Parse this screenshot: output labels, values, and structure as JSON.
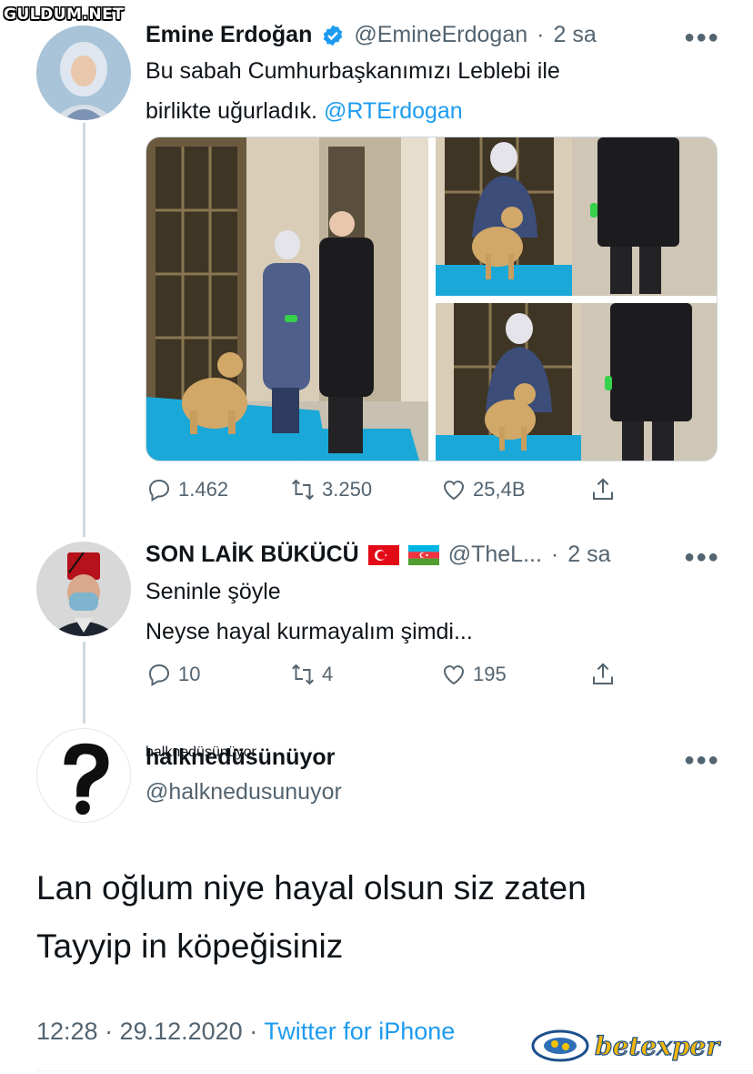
{
  "watermark": "GULDUM.NET",
  "tweet1": {
    "name": "Emine Erdoğan",
    "handle": "@EmineErdogan",
    "separator": "·",
    "time": "2 sa",
    "text_line1": "Bu sabah Cumhurbaşkanımızı Leblebi ile",
    "text_line2": "birlikte uğurladık.",
    "mention": "@RTErdogan",
    "replies": "1.462",
    "retweets": "3.250",
    "likes": "25,4B"
  },
  "tweet2": {
    "name": "SON LAİK BÜKÜCÜ",
    "handle": "@TheL...",
    "separator": "·",
    "time": "2 sa",
    "text_line1": "Seninle şöyle",
    "text_line2": "Neyse hayal kurmayalım şimdi...",
    "replies": "10",
    "retweets": "4",
    "likes": "195"
  },
  "tweet3": {
    "name": "halknedüsünüyor",
    "handle": "@halknedusunuyor",
    "text_line1": "Lan oğlum niye hayal olsun siz zaten",
    "text_line2": "Tayyip in köpeğisiniz",
    "timestamp": "12:28 · 29.12.2020",
    "separator": " · ",
    "source": "Twitter for iPhone"
  },
  "brand_logo": "betexper",
  "colors": {
    "accent": "#1d9bf0",
    "muted": "#536471",
    "verified": "#1d9bf0"
  },
  "icons": [
    "reply-icon",
    "retweet-icon",
    "like-icon",
    "share-icon",
    "verified-icon",
    "more-icon"
  ]
}
